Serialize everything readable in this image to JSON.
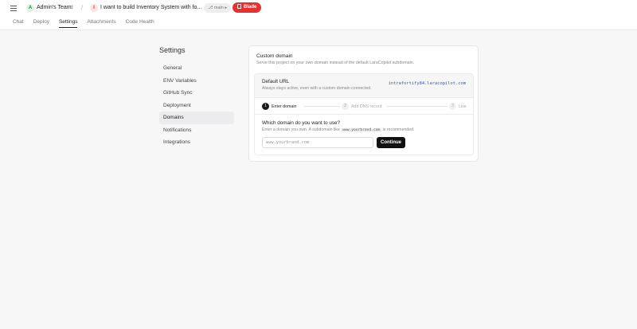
{
  "header": {
    "team_avatar": "A",
    "team_name": "Admin's Team",
    "separator": "/",
    "project_avatar": "I",
    "project_name": "I want to build Inventory System with fo...",
    "branch": "main",
    "blade_label": "Blade",
    "blade_color": "#e3322f"
  },
  "tabs": [
    {
      "label": "Chat"
    },
    {
      "label": "Deploy"
    },
    {
      "label": "Settings",
      "active": true
    },
    {
      "label": "Attachments"
    },
    {
      "label": "Code Health"
    }
  ],
  "settings": {
    "title": "Settings",
    "nav": [
      {
        "label": "General"
      },
      {
        "label": "ENV Variables"
      },
      {
        "label": "GitHub Sync"
      },
      {
        "label": "Deployment"
      },
      {
        "label": "Domains",
        "active": true
      },
      {
        "label": "Notifications"
      },
      {
        "label": "Integrations"
      }
    ]
  },
  "domain": {
    "title": "Custom domain",
    "description": "Serve this project on your own domain instead of the default LaraCopilot subdomain.",
    "default_url_label": "Default URL",
    "default_url_sub": "Always stays active, even with a custom domain connected.",
    "default_url_value": "intrafortify84.laracopilot.com",
    "steps": [
      {
        "num": "1",
        "label": "Enter domain",
        "active": true
      },
      {
        "num": "2",
        "label": "Add DNS record",
        "active": false
      },
      {
        "num": "3",
        "label": "Live",
        "active": false
      }
    ],
    "question": "Which domain do you want to use?",
    "hint_before": "Enter a domain you own. A subdomain like ",
    "hint_code": "www.yourbrand.com",
    "hint_after": " is recommended.",
    "input_placeholder": "www.yourbrand.com",
    "input_value": "",
    "continue_label": "Continue"
  }
}
